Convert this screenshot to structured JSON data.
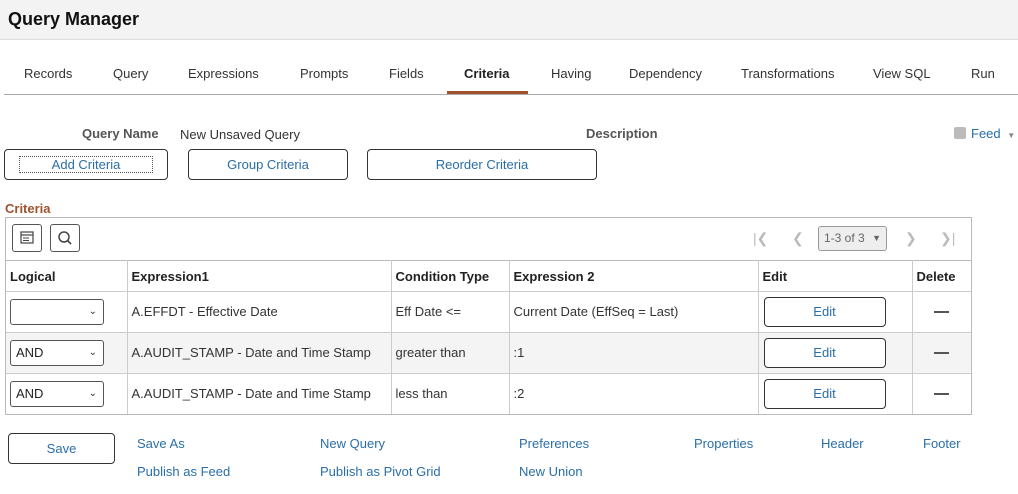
{
  "app": {
    "title": "Query Manager"
  },
  "tabs": [
    "Records",
    "Query",
    "Expressions",
    "Prompts",
    "Fields",
    "Criteria",
    "Having",
    "Dependency",
    "Transformations",
    "View SQL",
    "Run"
  ],
  "active_tab": "Criteria",
  "query": {
    "name_label": "Query Name",
    "name_value": "New Unsaved Query",
    "description_label": "Description",
    "feed_label": "Feed"
  },
  "buttons": {
    "add_criteria": "Add Criteria",
    "group_criteria": "Group Criteria",
    "reorder_criteria": "Reorder Criteria"
  },
  "criteria": {
    "title": "Criteria",
    "pager": "1-3 of 3",
    "columns": [
      "Logical",
      "Expression1",
      "Condition Type",
      "Expression 2",
      "Edit",
      "Delete"
    ],
    "rows": [
      {
        "logical": "",
        "expression1": "A.EFFDT - Effective Date",
        "condition": "Eff Date <=",
        "expression2": "Current Date (EffSeq = Last)",
        "edit": "Edit"
      },
      {
        "logical": "AND",
        "expression1": "A.AUDIT_STAMP - Date and Time Stamp",
        "condition": "greater than",
        "expression2": ":1",
        "edit": "Edit"
      },
      {
        "logical": "AND",
        "expression1": "A.AUDIT_STAMP - Date and Time Stamp",
        "condition": "less than",
        "expression2": ":2",
        "edit": "Edit"
      }
    ]
  },
  "footer": {
    "save": "Save",
    "save_as": "Save As",
    "publish_as_feed": "Publish as Feed",
    "new_query": "New Query",
    "publish_as_pivot_grid": "Publish as Pivot Grid",
    "preferences": "Preferences",
    "new_union": "New Union",
    "properties": "Properties",
    "header": "Header",
    "footer": "Footer"
  }
}
